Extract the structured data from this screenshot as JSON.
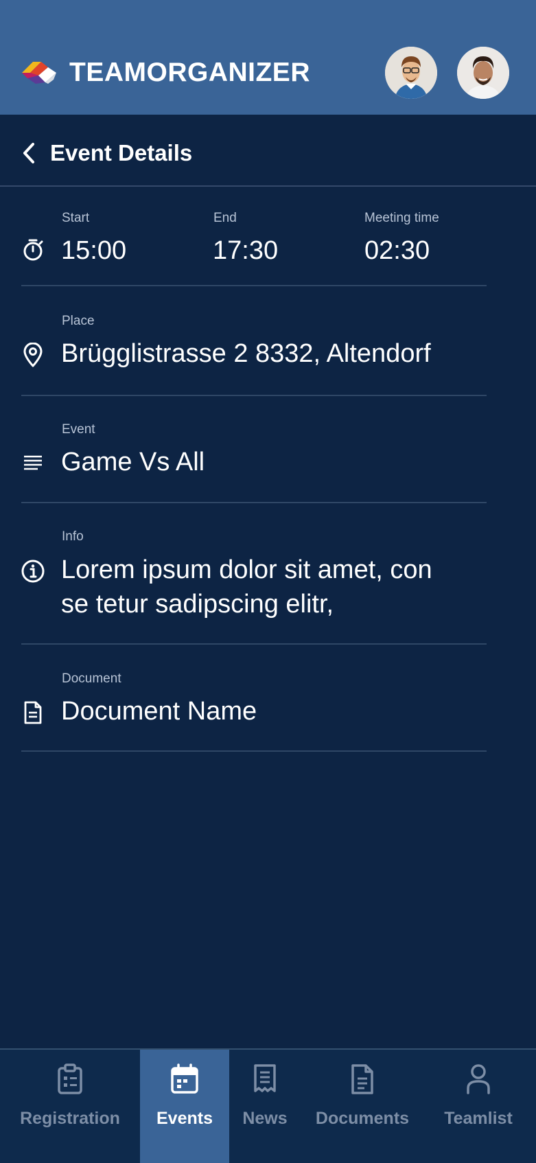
{
  "header": {
    "brand": "TEAMORGANIZER",
    "logo_icon": "teamorganizer-logo-icon",
    "avatars": [
      "avatar-user-1",
      "avatar-user-2"
    ],
    "colors": {
      "header_bg": "#3a6497",
      "page_bg": "#0d2444"
    }
  },
  "titlebar": {
    "back_icon": "chevron-left-icon",
    "title": "Event Details"
  },
  "details": {
    "time": {
      "icon": "stopwatch-icon",
      "start_label": "Start",
      "start_value": "15:00",
      "end_label": "End",
      "end_value": "17:30",
      "meeting_label": "Meeting time",
      "meeting_value": "02:30"
    },
    "place": {
      "icon": "location-pin-icon",
      "label": "Place",
      "value": "Brügglistrasse 2 8332, Altendorf"
    },
    "event": {
      "icon": "text-lines-icon",
      "label": "Event",
      "value": "Game Vs All"
    },
    "info": {
      "icon": "info-circle-icon",
      "label": "Info",
      "value_line1": "Lorem ipsum dolor sit amet, con",
      "value_line2": "se tetur sadipscing elitr,"
    },
    "document": {
      "icon": "document-icon",
      "label": "Document",
      "value": "Document Name"
    }
  },
  "bottom_nav": {
    "active": "Events",
    "items": [
      {
        "label": "Registration",
        "icon": "clipboard-icon"
      },
      {
        "label": "Events",
        "icon": "calendar-icon"
      },
      {
        "label": "News",
        "icon": "news-receipt-icon"
      },
      {
        "label": "Documents",
        "icon": "document-icon"
      },
      {
        "label": "Teamlist",
        "icon": "person-icon"
      }
    ]
  }
}
